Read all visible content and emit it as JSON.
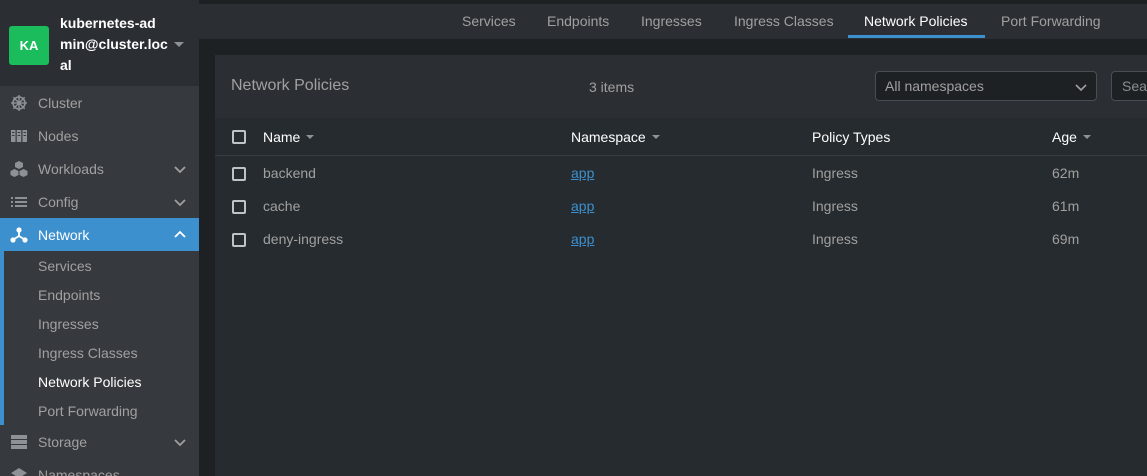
{
  "cluster": {
    "avatar": "KA",
    "name": "kubernetes-admin@cluster.local"
  },
  "sidebar": {
    "items": [
      {
        "label": "Cluster",
        "icon": "helm-wheel-icon"
      },
      {
        "label": "Nodes",
        "icon": "server-rack-icon"
      },
      {
        "label": "Workloads",
        "icon": "cubes-icon"
      },
      {
        "label": "Config",
        "icon": "list-icon"
      },
      {
        "label": "Network",
        "icon": "network-tree-icon"
      },
      {
        "label": "Storage",
        "icon": "storage-icon"
      },
      {
        "label": "Namespaces",
        "icon": "layers-icon"
      }
    ],
    "network_sub": [
      "Services",
      "Endpoints",
      "Ingresses",
      "Ingress Classes",
      "Network Policies",
      "Port Forwarding"
    ]
  },
  "tabs": [
    "Services",
    "Endpoints",
    "Ingresses",
    "Ingress Classes",
    "Network Policies",
    "Port Forwarding"
  ],
  "panel": {
    "title": "Network Policies",
    "count": "3 items",
    "namespace_select": "All namespaces",
    "search_placeholder": "Search"
  },
  "table": {
    "headers": [
      "Name",
      "Namespace",
      "Policy Types",
      "Age"
    ],
    "rows": [
      {
        "name": "backend",
        "namespace": "app",
        "policy_types": "Ingress",
        "age": "62m"
      },
      {
        "name": "cache",
        "namespace": "app",
        "policy_types": "Ingress",
        "age": "61m"
      },
      {
        "name": "deny-ingress",
        "namespace": "app",
        "policy_types": "Ingress",
        "age": "69m"
      }
    ]
  },
  "colors": {
    "accent": "#3d90ce",
    "avatar": "#1abc5c",
    "sidebar_bg": "#36393e",
    "content_bg": "#1e2124"
  }
}
